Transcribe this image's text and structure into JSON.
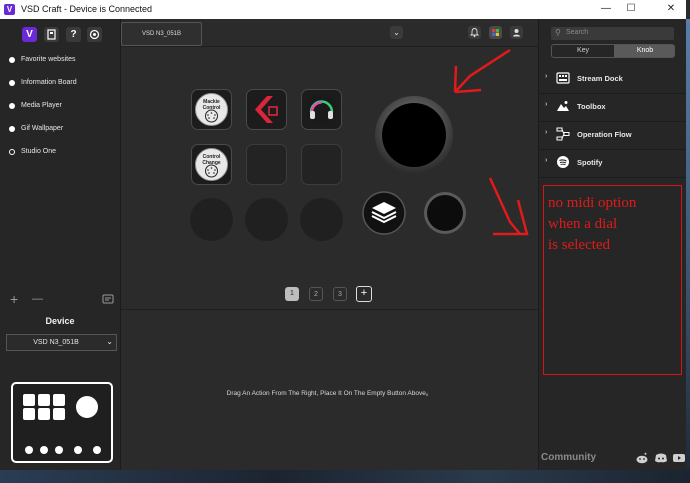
{
  "window": {
    "logo_letter": "V",
    "title": "VSD Craft - Device is Connected",
    "minimize": "—",
    "maximize": "☐",
    "close": "✕"
  },
  "sidebar": {
    "profiles": [
      {
        "label": "Favorite websites",
        "selected": false
      },
      {
        "label": "Information Board",
        "selected": false
      },
      {
        "label": "Media Player",
        "selected": false
      },
      {
        "label": "Gif Wallpaper",
        "selected": false
      },
      {
        "label": "Studio One",
        "selected": true
      }
    ],
    "add_label": "+",
    "remove_label": "—",
    "device_heading": "Device",
    "device_select_value": "VSD N3_051B"
  },
  "main": {
    "device_tab": "VSD N3_051B",
    "keys": [
      {
        "id": "mackie-control",
        "label_top": "Mackie",
        "label_bottom": "Control"
      },
      {
        "id": "control-change",
        "label_top": "Control",
        "label_bottom": "Change"
      }
    ],
    "pages": [
      "1",
      "2",
      "3"
    ],
    "add_page": "+",
    "hint": "Drag An Action From The Right, Place It On The Empty Button Above。"
  },
  "right_panel": {
    "search_placeholder": "Search",
    "segments": [
      "Key",
      "Knob"
    ],
    "active_segment": "Knob",
    "categories": [
      {
        "label": "Stream Dock",
        "icon": "keyboard-icon"
      },
      {
        "label": "Toolbox",
        "icon": "toolbox-icon"
      },
      {
        "label": "Operation Flow",
        "icon": "flow-icon"
      },
      {
        "label": "Spotify",
        "icon": "spotify-icon"
      }
    ],
    "footer": "Community"
  },
  "annotation": {
    "text": "no midi option\nwhen a dial\nis selected",
    "color": "#e11a1a"
  }
}
